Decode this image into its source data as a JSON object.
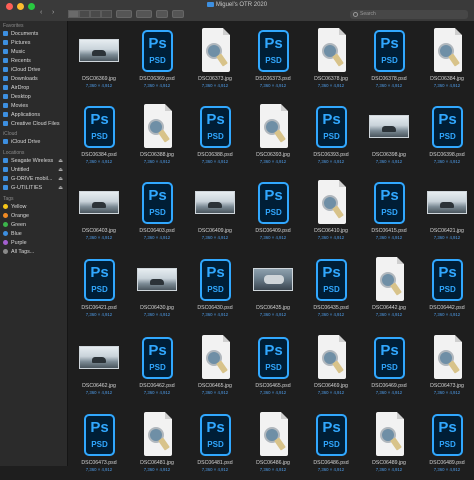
{
  "window": {
    "title": "Miguel's OTR 2020",
    "search_placeholder": "Search",
    "traffic_lights": [
      "#ff5f57",
      "#febc2e",
      "#28c840"
    ],
    "accent": "#3d8fe0"
  },
  "sidebar": {
    "favorites_header": "Favorites",
    "favorites": [
      {
        "label": "Documents",
        "icon": "documents-icon"
      },
      {
        "label": "Pictures",
        "icon": "pictures-icon"
      },
      {
        "label": "Music",
        "icon": "music-icon"
      },
      {
        "label": "Recents",
        "icon": "recents-icon"
      },
      {
        "label": "iCloud Drive",
        "icon": "cloud-icon"
      },
      {
        "label": "Downloads",
        "icon": "downloads-icon"
      },
      {
        "label": "AirDrop",
        "icon": "airdrop-icon"
      },
      {
        "label": "Desktop",
        "icon": "desktop-icon"
      },
      {
        "label": "Movies",
        "icon": "movies-icon"
      },
      {
        "label": "Applications",
        "icon": "applications-icon"
      },
      {
        "label": "Creative Cloud Files",
        "icon": "creative-cloud-icon"
      }
    ],
    "icloud_header": "iCloud",
    "icloud": [
      {
        "label": "iCloud Drive",
        "icon": "cloud-icon"
      }
    ],
    "locations_header": "Locations",
    "locations": [
      {
        "label": "Seagate Wireless",
        "icon": "drive-icon"
      },
      {
        "label": "Untitled",
        "icon": "drive-icon"
      },
      {
        "label": "G-DRIVE mobil...",
        "icon": "drive-icon"
      },
      {
        "label": "G-UTILITIES",
        "icon": "drive-icon"
      }
    ],
    "tags_header": "Tags",
    "tags": [
      {
        "label": "Yellow",
        "color": "#f5c518"
      },
      {
        "label": "Orange",
        "color": "#f08a24"
      },
      {
        "label": "Green",
        "color": "#3cb44b"
      },
      {
        "label": "Blue",
        "color": "#3d8fe0"
      },
      {
        "label": "Purple",
        "color": "#a35fd0"
      },
      {
        "label": "All Tags...",
        "color": "#8a8a8a"
      }
    ]
  },
  "files": [
    {
      "name": "DSC06369.jpg",
      "size": "7,360 × 4,912",
      "kind": "photo"
    },
    {
      "name": "DSC06369.psd",
      "size": "7,360 × 4,912",
      "kind": "psd"
    },
    {
      "name": "DSC06373.jpg",
      "size": "7,360 × 4,912",
      "kind": "doc"
    },
    {
      "name": "DSC06373.psd",
      "size": "7,360 × 4,912",
      "kind": "psd"
    },
    {
      "name": "DSC06378.jpg",
      "size": "7,360 × 4,912",
      "kind": "doc"
    },
    {
      "name": "DSC06378.psd",
      "size": "7,360 × 4,912",
      "kind": "psd"
    },
    {
      "name": "DSC06384.jpg",
      "size": "7,360 × 4,912",
      "kind": "doc"
    },
    {
      "name": "DSC06384.psd",
      "size": "7,360 × 4,912",
      "kind": "psd"
    },
    {
      "name": "DSC06388.jpg",
      "size": "7,360 × 4,912",
      "kind": "doc"
    },
    {
      "name": "DSC06388.psd",
      "size": "7,360 × 4,912",
      "kind": "psd"
    },
    {
      "name": "DSC06393.jpg",
      "size": "7,360 × 4,912",
      "kind": "doc"
    },
    {
      "name": "DSC06393.psd",
      "size": "7,360 × 4,912",
      "kind": "psd"
    },
    {
      "name": "DSC06398.jpg",
      "size": "7,360 × 4,912",
      "kind": "photo"
    },
    {
      "name": "DSC06398.psd",
      "size": "7,360 × 4,912",
      "kind": "psd"
    },
    {
      "name": "DSC06403.jpg",
      "size": "7,360 × 4,912",
      "kind": "photo"
    },
    {
      "name": "DSC06403.psd",
      "size": "7,360 × 4,912",
      "kind": "psd"
    },
    {
      "name": "DSC06409.jpg",
      "size": "7,360 × 4,912",
      "kind": "photo"
    },
    {
      "name": "DSC06409.psd",
      "size": "7,360 × 4,912",
      "kind": "psd"
    },
    {
      "name": "DSC06410.jpg",
      "size": "7,360 × 4,912",
      "kind": "doc"
    },
    {
      "name": "DSC06415.psd",
      "size": "7,360 × 4,912",
      "kind": "psd"
    },
    {
      "name": "DSC06421.jpg",
      "size": "7,360 × 4,912",
      "kind": "photo"
    },
    {
      "name": "DSC06421.psd",
      "size": "7,360 × 4,912",
      "kind": "psd"
    },
    {
      "name": "DSC06430.jpg",
      "size": "7,360 × 4,912",
      "kind": "photo"
    },
    {
      "name": "DSC06430.psd",
      "size": "7,360 × 4,912",
      "kind": "psd"
    },
    {
      "name": "DSC06435.jpg",
      "size": "7,360 × 4,912",
      "kind": "photo2"
    },
    {
      "name": "DSC06435.psd",
      "size": "7,360 × 4,912",
      "kind": "psd"
    },
    {
      "name": "DSC06442.jpg",
      "size": "7,360 × 4,912",
      "kind": "doc"
    },
    {
      "name": "DSC06442.psd",
      "size": "7,360 × 4,912",
      "kind": "psd"
    },
    {
      "name": "DSC06462.jpg",
      "size": "7,360 × 4,912",
      "kind": "photo"
    },
    {
      "name": "DSC06462.psd",
      "size": "7,360 × 4,912",
      "kind": "psd"
    },
    {
      "name": "DSC06465.jpg",
      "size": "7,360 × 4,912",
      "kind": "doc"
    },
    {
      "name": "DSC06465.psd",
      "size": "7,360 × 4,912",
      "kind": "psd"
    },
    {
      "name": "DSC06469.jpg",
      "size": "7,360 × 4,912",
      "kind": "doc"
    },
    {
      "name": "DSC06469.psd",
      "size": "7,360 × 4,912",
      "kind": "psd"
    },
    {
      "name": "DSC06473.jpg",
      "size": "7,360 × 4,912",
      "kind": "doc"
    },
    {
      "name": "DSC06473.psd",
      "size": "7,360 × 4,912",
      "kind": "psd"
    },
    {
      "name": "DSC06481.jpg",
      "size": "7,360 × 4,912",
      "kind": "doc"
    },
    {
      "name": "DSC06481.psd",
      "size": "7,360 × 4,912",
      "kind": "psd"
    },
    {
      "name": "DSC06486.jpg",
      "size": "7,360 × 4,912",
      "kind": "doc"
    },
    {
      "name": "DSC06486.psd",
      "size": "7,360 × 4,912",
      "kind": "psd"
    },
    {
      "name": "DSC06489.jpg",
      "size": "7,360 × 4,912",
      "kind": "doc"
    },
    {
      "name": "DSC06489.psd",
      "size": "7,360 × 4,912",
      "kind": "psd"
    }
  ],
  "psd_badge": {
    "top": "Ps",
    "bottom": "PSD",
    "color": "#31a8ff",
    "bg": "#001e36"
  }
}
